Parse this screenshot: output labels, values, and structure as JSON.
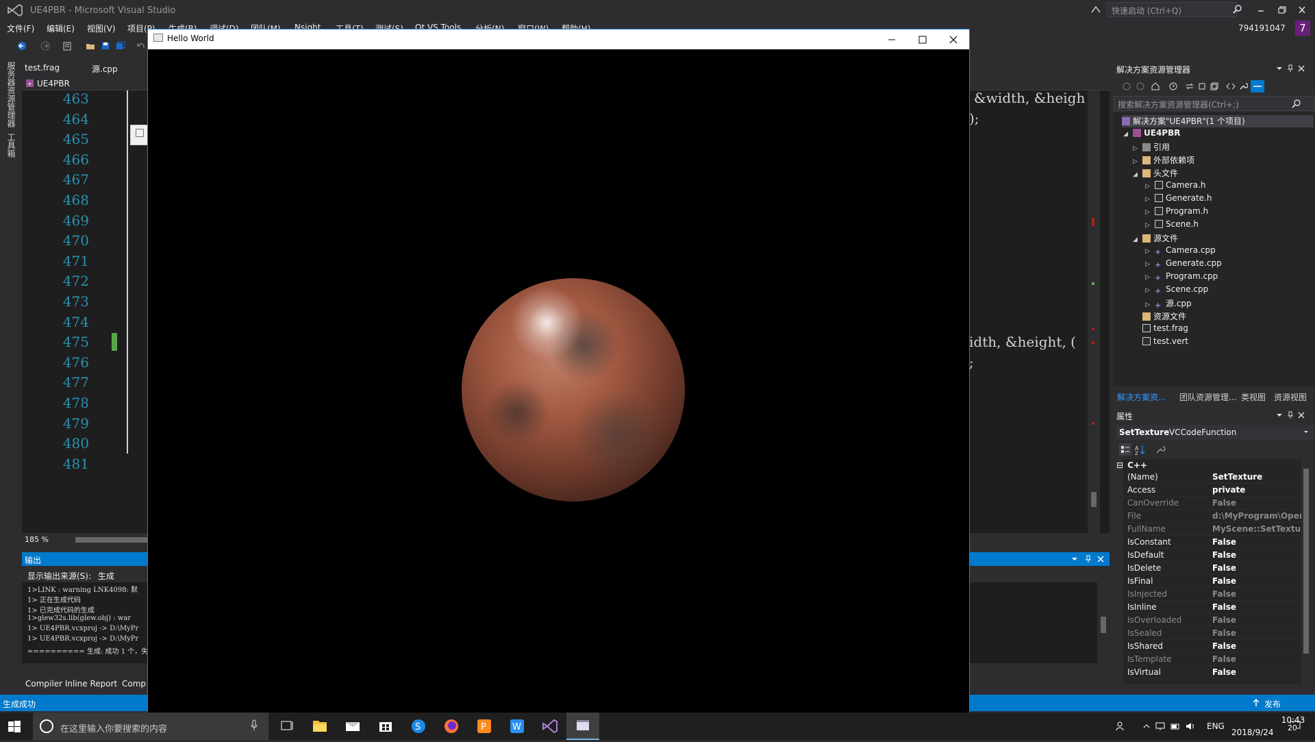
{
  "vs": {
    "title": "UE4PBR - Microsoft Visual Studio",
    "quick_launch_placeholder": "快速启动 (Ctrl+Q)",
    "user_id": "794191047",
    "user_badge": "7",
    "menu": [
      "文件(F)",
      "编辑(E)",
      "视图(V)",
      "项目(P)",
      "生成(B)",
      "调试(D)",
      "团队(M)",
      "Nsight",
      "工具(T)",
      "测试(S)",
      "Qt VS Tools",
      "分析(N)",
      "窗口(W)",
      "帮助(H)"
    ],
    "left_strip": [
      "服务器资源管理器",
      "工具箱"
    ]
  },
  "editor": {
    "tabs": [
      "test.frag",
      "源.cpp"
    ],
    "project_dropdown": "UE4PBR",
    "line_numbers": [
      "463",
      "464",
      "465",
      "466",
      "467",
      "468",
      "469",
      "470",
      "471",
      "472",
      "473",
      "474",
      "475",
      "476",
      "477",
      "478",
      "479",
      "480",
      "481"
    ],
    "code_fragments": [
      {
        "text": "&width, &heigh"
      },
      {
        "text": ");"
      },
      {
        "text": "idth, &height, ("
      },
      {
        "text": ";"
      }
    ],
    "zoom": "185 %"
  },
  "output": {
    "title": "输出",
    "source_label": "显示输出来源(S):",
    "source_value": "生成",
    "lines": [
      "1>LINK : warning LNK4098: 默",
      "1>  正在生成代码",
      "1>  已完成代码的生成",
      "1>glew32s.lib(glew.obj) : war",
      "1>  UE4PBR.vcxproj -> D:\\MyPr",
      "1>  UE4PBR.vcxproj -> D:\\MyPr",
      "========== 生成: 成功 1 个，失"
    ],
    "tabs": [
      "Compiler Inline Report",
      "Comp"
    ]
  },
  "status": {
    "text": "生成成功",
    "publish": "发布"
  },
  "solution_explorer": {
    "title": "解决方案资源管理器",
    "search_placeholder": "搜索解决方案资源管理器(Ctrl+;)",
    "items": [
      {
        "label": "解决方案\"UE4PBR\"(1 个项目)",
        "kind": "solution",
        "level": 0,
        "expander": ""
      },
      {
        "label": "UE4PBR",
        "kind": "project",
        "level": 1,
        "expander": "◢"
      },
      {
        "label": "引用",
        "kind": "ref",
        "level": 2,
        "expander": "▷"
      },
      {
        "label": "外部依赖项",
        "kind": "folder",
        "level": 2,
        "expander": "▷"
      },
      {
        "label": "头文件",
        "kind": "folder",
        "level": 2,
        "expander": "◢"
      },
      {
        "label": "Camera.h",
        "kind": "file",
        "level": 3,
        "expander": "▷"
      },
      {
        "label": "Generate.h",
        "kind": "file",
        "level": 3,
        "expander": "▷"
      },
      {
        "label": "Program.h",
        "kind": "file",
        "level": 3,
        "expander": "▷"
      },
      {
        "label": "Scene.h",
        "kind": "file",
        "level": 3,
        "expander": "▷"
      },
      {
        "label": "源文件",
        "kind": "folder",
        "level": 2,
        "expander": "◢"
      },
      {
        "label": "Camera.cpp",
        "kind": "cpp",
        "level": 3,
        "expander": "▷"
      },
      {
        "label": "Generate.cpp",
        "kind": "cpp",
        "level": 3,
        "expander": "▷"
      },
      {
        "label": "Program.cpp",
        "kind": "cpp",
        "level": 3,
        "expander": "▷"
      },
      {
        "label": "Scene.cpp",
        "kind": "cpp",
        "level": 3,
        "expander": "▷"
      },
      {
        "label": "源.cpp",
        "kind": "cpp",
        "level": 3,
        "expander": "▷"
      },
      {
        "label": "资源文件",
        "kind": "folder",
        "level": 2,
        "expander": ""
      },
      {
        "label": "test.frag",
        "kind": "file",
        "level": 2,
        "expander": ""
      },
      {
        "label": "test.vert",
        "kind": "file",
        "level": 2,
        "expander": ""
      }
    ],
    "tabs": [
      "解决方案资...",
      "团队资源管理...",
      "类视图",
      "资源视图"
    ]
  },
  "properties": {
    "title": "属性",
    "object_name": "SetTexture",
    "object_type": "VCCodeFunction",
    "category": "C++",
    "rows": [
      {
        "name": "(Name)",
        "value": "SetTexture",
        "dim": false
      },
      {
        "name": "Access",
        "value": "private",
        "dim": false
      },
      {
        "name": "CanOverride",
        "value": "False",
        "dim": true
      },
      {
        "name": "File",
        "value": "d:\\MyProgram\\Oper",
        "dim": true
      },
      {
        "name": "FullName",
        "value": "MyScene::SetTexture",
        "dim": true
      },
      {
        "name": "IsConstant",
        "value": "False",
        "dim": false
      },
      {
        "name": "IsDefault",
        "value": "False",
        "dim": false
      },
      {
        "name": "IsDelete",
        "value": "False",
        "dim": false
      },
      {
        "name": "IsFinal",
        "value": "False",
        "dim": false
      },
      {
        "name": "IsInjected",
        "value": "False",
        "dim": true
      },
      {
        "name": "IsInline",
        "value": "False",
        "dim": false
      },
      {
        "name": "IsOverloaded",
        "value": "False",
        "dim": true
      },
      {
        "name": "IsSealed",
        "value": "False",
        "dim": true
      },
      {
        "name": "IsShared",
        "value": "False",
        "dim": false
      },
      {
        "name": "IsTemplate",
        "value": "False",
        "dim": true
      },
      {
        "name": "IsVirtual",
        "value": "False",
        "dim": false
      }
    ]
  },
  "hello_window": {
    "title": "Hello World"
  },
  "taskbar": {
    "search_placeholder": "在这里输入你要搜索的内容",
    "apps": [
      "task-view-icon",
      "file-explorer-icon",
      "mail-icon",
      "store-icon",
      "sogou-icon",
      "firefox-icon",
      "presentation-icon",
      "writer-icon",
      "visual-studio-icon",
      "hello-world-window-icon"
    ],
    "lang": "ENG",
    "time": "10:43",
    "date": "2018/9/24",
    "notifications": "20"
  },
  "colors": {
    "accent": "#007acc",
    "vs_purple": "#68217a",
    "editor_bg": "#1e1e1e",
    "line_number": "#2b91af"
  }
}
